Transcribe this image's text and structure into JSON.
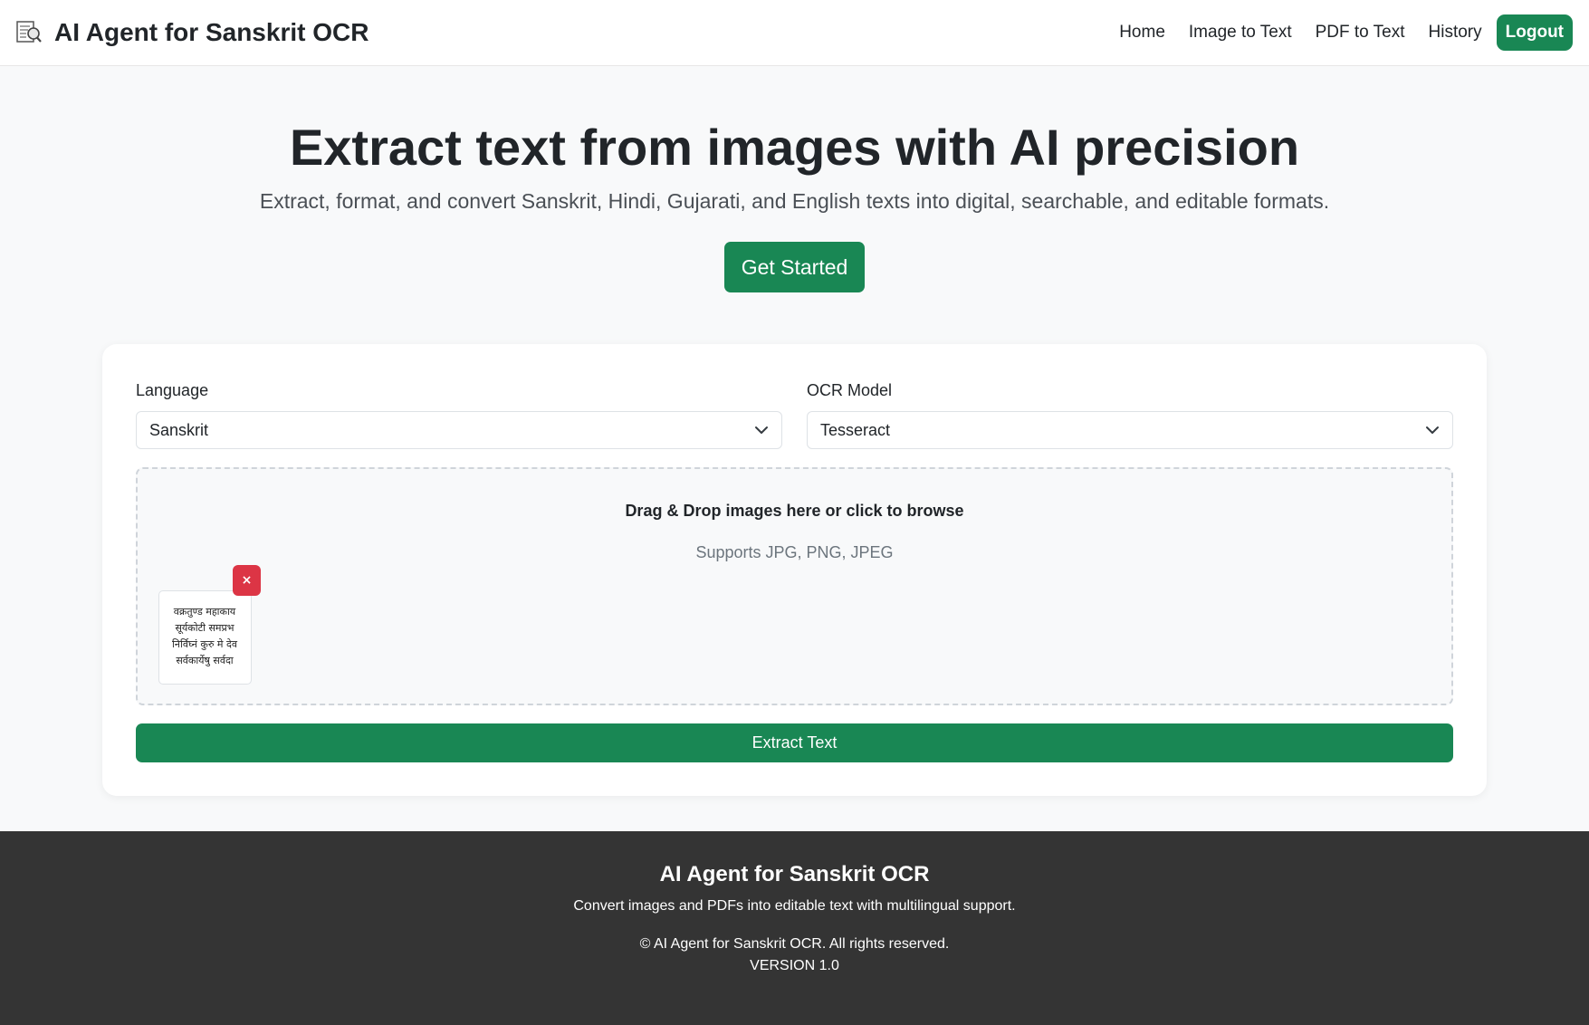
{
  "header": {
    "brand_title": "AI Agent for Sanskrit OCR",
    "brand_icon": "document-search-icon",
    "nav": [
      {
        "label": "Home"
      },
      {
        "label": "Image to Text"
      },
      {
        "label": "PDF to Text"
      },
      {
        "label": "History"
      }
    ],
    "logout_label": "Logout"
  },
  "hero": {
    "title": "Extract text from images with AI precision",
    "subtitle": "Extract, format, and convert Sanskrit, Hindi, Gujarati, and English texts into digital, searchable, and editable formats.",
    "cta_label": "Get Started"
  },
  "form": {
    "language_label": "Language",
    "language_value": "Sanskrit",
    "model_label": "OCR Model",
    "model_value": "Tesseract",
    "dropzone_title": "Drag & Drop images here or click to browse",
    "dropzone_sub": "Supports JPG, PNG, JPEG",
    "thumbnail_lines": [
      "वक्रतुण्ड महाकाय",
      "सूर्यकोटी समप्रभ",
      "निर्विघ्नं कुरु मे देव",
      "सर्वकार्येषु सर्वदा"
    ],
    "remove_label": "×",
    "extract_label": "Extract Text"
  },
  "footer": {
    "title": "AI Agent for Sanskrit OCR",
    "description": "Convert images and PDFs into editable text with multilingual support.",
    "copyright": "© AI Agent for Sanskrit OCR. All rights reserved.",
    "version": "VERSION 1.0"
  },
  "colors": {
    "primary": "#198754",
    "danger": "#dc3545",
    "footer_bg": "#343434",
    "page_bg": "#f8f9fa"
  }
}
